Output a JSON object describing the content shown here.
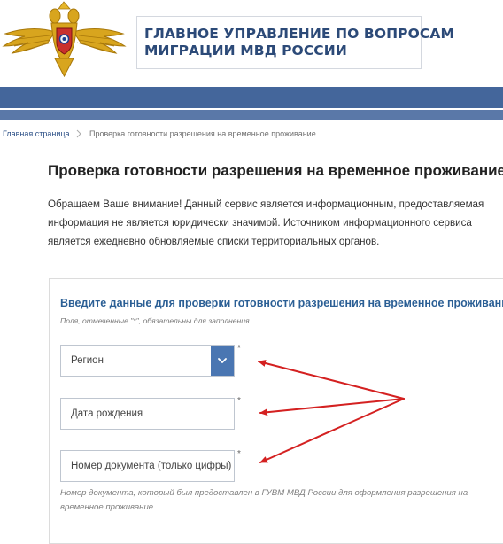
{
  "header": {
    "title_line1": "ГЛАВНОЕ УПРАВЛЕНИЕ ПО ВОПРОСАМ",
    "title_line2": "МИГРАЦИИ МВД РОССИИ"
  },
  "breadcrumb": {
    "home": "Главная страница",
    "current": "Проверка готовности разрешения на временное проживание"
  },
  "page": {
    "title": "Проверка готовности разрешения на временное проживание",
    "intro": "Обращаем Ваше внимание! Данный сервис является информационным, предоставляемая информация не является юридически значимой. Источником информационного сервиса является ежедневно обновляемые списки территориальных органов."
  },
  "form": {
    "title": "Введите данные для проверки готовности разрешения на временное проживание",
    "required_note": "Поля, отмеченные \"*\", обязательны для заполнения",
    "required_mark": "*",
    "region_placeholder": "Регион",
    "birthdate_placeholder": "Дата рождения",
    "document_placeholder": "Номер документа (только цифры)",
    "document_hint": "Номер документа, который был предоставлен в ГУВМ МВД России для оформления разрешения на временное проживание"
  },
  "icons": {
    "emblem": "russia-mvd-emblem-icon",
    "dropdown": "chevron-down-icon",
    "breadcrumb_separator": "chevron-right-icon"
  },
  "colors": {
    "header_title": "#2c4a78",
    "nav_stripe": "#44669b",
    "form_title": "#2b5f95",
    "dropdown_button": "#4a76b2",
    "annotation_arrows": "#d42121"
  }
}
